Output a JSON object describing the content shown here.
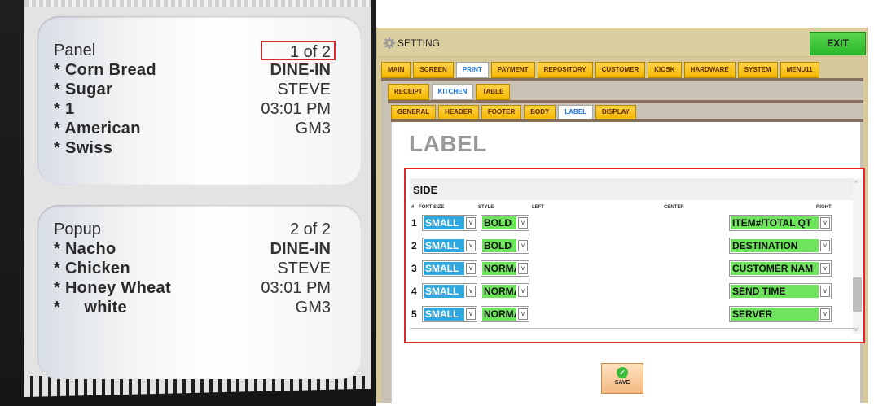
{
  "photo": {
    "label1": {
      "items": [
        "Panel",
        "* Corn Bread",
        "* Sugar",
        "* 1",
        "* American",
        "* Swiss"
      ],
      "page": "1 of 2",
      "fields": [
        "DINE-IN",
        "STEVE",
        "03:01 PM",
        "GM3"
      ]
    },
    "label2": {
      "items": [
        "Popup",
        "* Nacho",
        "* Chicken",
        "* Honey Wheat",
        "*     white"
      ],
      "page": "2 of 2",
      "fields": [
        "DINE-IN",
        "STEVE",
        "03:01 PM",
        "GM3"
      ]
    }
  },
  "window": {
    "title": "SETTING",
    "exit": "EXIT"
  },
  "tabs_main": [
    "MAIN",
    "SCREEN",
    "PRINT",
    "PAYMENT",
    "REPOSITORY",
    "CUSTOMER",
    "KIOSK",
    "HARDWARE",
    "SYSTEM",
    "MENU11"
  ],
  "tabs_main_active": "PRINT",
  "tabs_print": [
    "RECEIPT",
    "KITCHEN",
    "TABLE"
  ],
  "tabs_print_active": "KITCHEN",
  "tabs_kitchen": [
    "GENERAL",
    "HEADER",
    "FOOTER",
    "BODY",
    "LABEL",
    "DISPLAY"
  ],
  "tabs_kitchen_active": "LABEL",
  "page_title": "LABEL",
  "side": {
    "title": "SIDE",
    "headers": {
      "num": "#",
      "font_size": "FONT SIZE",
      "style": "STYLE",
      "left": "LEFT",
      "center": "CENTER",
      "right": "RIGHT"
    },
    "rows": [
      {
        "num": "1",
        "font_size": "SMALL",
        "style": "BOLD",
        "right": "ITEM#/TOTAL QT"
      },
      {
        "num": "2",
        "font_size": "SMALL",
        "style": "BOLD",
        "right": "DESTINATION"
      },
      {
        "num": "3",
        "font_size": "SMALL",
        "style": "NORMA",
        "right": "CUSTOMER NAM"
      },
      {
        "num": "4",
        "font_size": "SMALL",
        "style": "NORMA",
        "right": "SEND TIME"
      },
      {
        "num": "5",
        "font_size": "SMALL",
        "style": "NORMA",
        "right": "SERVER"
      }
    ]
  },
  "save_label": "SAVE",
  "colors": {
    "highlight_red": "#e2252a",
    "tab_yellow": "#f5b800",
    "select_blue": "#2fa8df",
    "select_green": "#6de45c",
    "exit_green": "#2bb82a"
  }
}
